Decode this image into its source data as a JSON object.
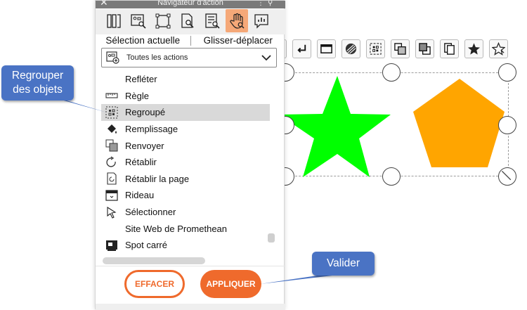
{
  "window": {
    "title": "Navigateur d'action",
    "close_glyph": "✕",
    "more_glyph": "⋮",
    "pin_glyph": "⚲"
  },
  "tabs": [
    {
      "name": "tab-pages",
      "icon": "pages-icon"
    },
    {
      "name": "tab-objects-search",
      "icon": "objects-search-icon"
    },
    {
      "name": "tab-frame",
      "icon": "frame-icon"
    },
    {
      "name": "tab-page-search",
      "icon": "page-search-icon"
    },
    {
      "name": "tab-list-search",
      "icon": "list-search-icon"
    },
    {
      "name": "tab-action",
      "icon": "hand-pointer-icon",
      "active": true
    },
    {
      "name": "tab-chart",
      "icon": "chart-icon"
    }
  ],
  "modes": {
    "left": "Sélection actuelle",
    "right": "Glisser-déplacer"
  },
  "filter": {
    "selected": "Toutes les actions"
  },
  "actions": [
    {
      "label": "Refléter",
      "icon": "none"
    },
    {
      "label": "Règle",
      "icon": "ruler-icon"
    },
    {
      "label": "Regroupé",
      "icon": "group-icon",
      "selected": true
    },
    {
      "label": "Remplissage",
      "icon": "fill-bucket-icon"
    },
    {
      "label": "Renvoyer",
      "icon": "send-back-icon"
    },
    {
      "label": "Rétablir",
      "icon": "redo-icon"
    },
    {
      "label": "Rétablir la page",
      "icon": "reset-page-icon"
    },
    {
      "label": "Rideau",
      "icon": "curtain-icon"
    },
    {
      "label": "Sélectionner",
      "icon": "select-arrow-icon"
    },
    {
      "label": "Site Web de Promethean",
      "icon": "none"
    },
    {
      "label": "Spot carré",
      "icon": "spotlight-icon"
    }
  ],
  "buttons": {
    "clear": "EFFACER",
    "apply": "APPLIQUER"
  },
  "callouts": {
    "group_line1": "Regrouper",
    "group_line2": "des objets",
    "validate": "Valider"
  },
  "colors": {
    "accent": "#ef6a2c",
    "active_tab": "#f5a878",
    "callout": "#4a73c4",
    "star": "#00ff00",
    "pentagon": "#ffa500"
  }
}
